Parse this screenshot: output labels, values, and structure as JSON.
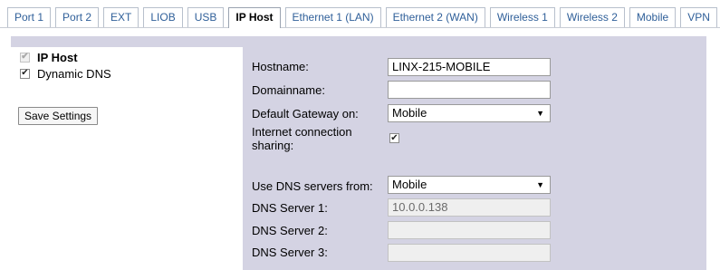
{
  "tabs": [
    {
      "label": "Port 1",
      "active": false
    },
    {
      "label": "Port 2",
      "active": false
    },
    {
      "label": "EXT",
      "active": false
    },
    {
      "label": "LIOB",
      "active": false
    },
    {
      "label": "USB",
      "active": false
    },
    {
      "label": "IP Host",
      "active": true
    },
    {
      "label": "Ethernet 1 (LAN)",
      "active": false
    },
    {
      "label": "Ethernet 2 (WAN)",
      "active": false
    },
    {
      "label": "Wireless 1",
      "active": false
    },
    {
      "label": "Wireless 2",
      "active": false
    },
    {
      "label": "Mobile",
      "active": false
    },
    {
      "label": "VPN",
      "active": false
    }
  ],
  "tree": {
    "ip_host": {
      "label": "IP Host",
      "checked": true,
      "disabled": true
    },
    "dynamic_dns": {
      "label": "Dynamic DNS",
      "checked": true
    }
  },
  "save_button": "Save Settings",
  "form": {
    "hostname": {
      "label": "Hostname:",
      "value": "LINX-215-MOBILE"
    },
    "domainname": {
      "label": "Domainname:",
      "value": ""
    },
    "default_gateway": {
      "label": "Default Gateway on:",
      "value": "Mobile"
    },
    "ics": {
      "label_line1": "Internet connection",
      "label_line2": "sharing:",
      "checked": true
    },
    "dns_from": {
      "label": "Use DNS servers from:",
      "value": "Mobile"
    },
    "dns1": {
      "label": "DNS Server 1:",
      "value": "10.0.0.138"
    },
    "dns2": {
      "label": "DNS Server 2:",
      "value": ""
    },
    "dns3": {
      "label": "DNS Server 3:",
      "value": ""
    }
  },
  "colors": {
    "panel_bg": "#d4d3e3",
    "tab_link": "#2f5f99"
  },
  "icons": {
    "dropdown": "triangle-down",
    "check": "check-mark"
  }
}
